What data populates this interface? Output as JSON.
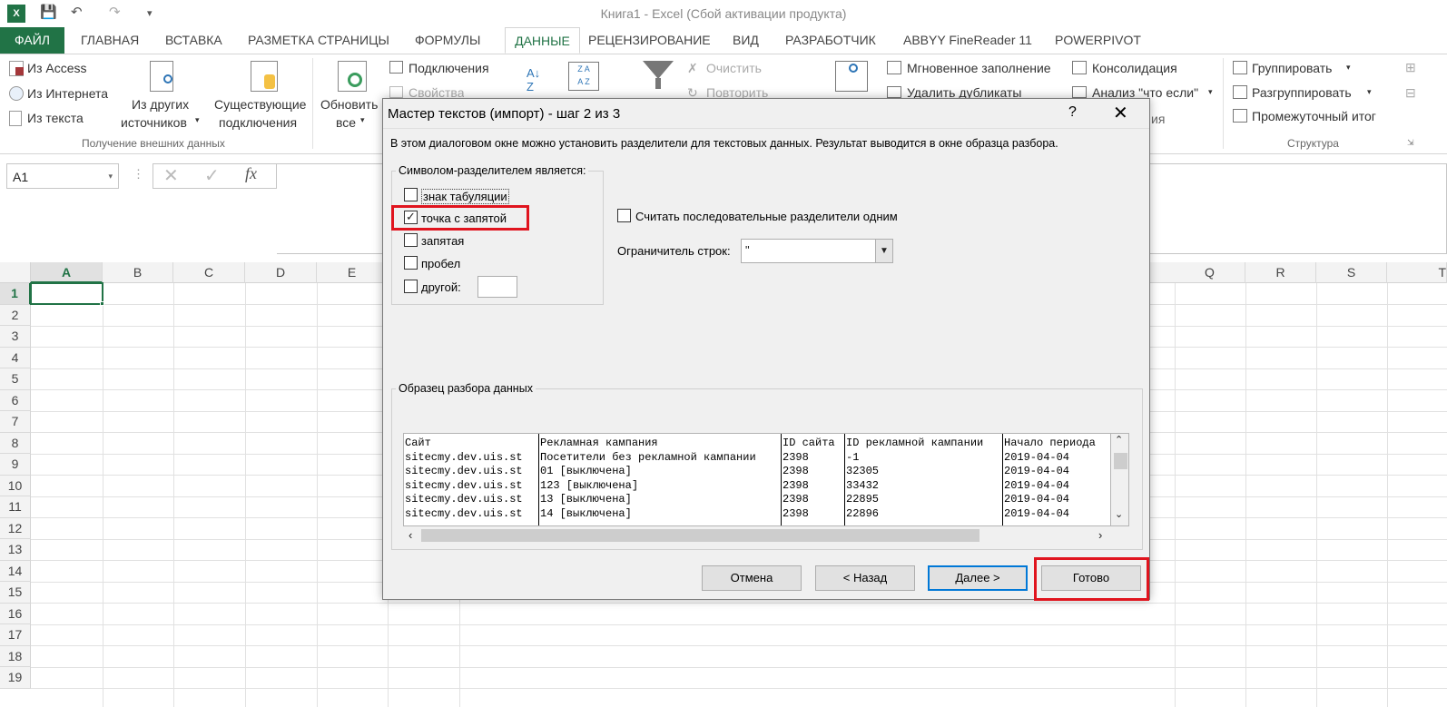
{
  "app": {
    "title": "Книга1 - Excel (Сбой активации продукта)"
  },
  "tabs": {
    "file": "ФАЙЛ",
    "items": [
      "ГЛАВНАЯ",
      "ВСТАВКА",
      "РАЗМЕТКА СТРАНИЦЫ",
      "ФОРМУЛЫ",
      "ДАННЫЕ",
      "РЕЦЕНЗИРОВАНИЕ",
      "ВИД",
      "РАЗРАБОТЧИК",
      "ABBYY FineReader 11",
      "POWERPIVOT"
    ]
  },
  "ribbon": {
    "access": "Из Access",
    "internet": "Из Интернета",
    "text": "Из текста",
    "other_sources_1": "Из других",
    "other_sources_2": "источников",
    "existing_1": "Существующие",
    "existing_2": "подключения",
    "refresh_1": "Обновить",
    "refresh_2": "все",
    "connections": "Подключения",
    "properties": "Свойства",
    "clear": "Очистить",
    "reapply": "Повторить",
    "flash_fill": "Мгновенное заполнение",
    "remove_dup": "Удалить дубликаты",
    "consolidate": "Консолидация",
    "whatif": "Анализ \"что если\"",
    "group": "Группировать",
    "ungroup": "Разгруппировать",
    "subtotal": "Промежуточный итог",
    "group_ext": "Получение внешних данных",
    "group_struct": "Структура",
    "group_partial": "ия"
  },
  "formula": {
    "namebox": "A1",
    "fx": "fx"
  },
  "grid": {
    "columns": [
      "A",
      "B",
      "C",
      "D",
      "E",
      "Q",
      "R",
      "S",
      "T"
    ],
    "rows": [
      "1",
      "2",
      "3",
      "4",
      "5",
      "6",
      "7",
      "8",
      "9",
      "10",
      "11",
      "12",
      "13",
      "14",
      "15",
      "16",
      "17",
      "18",
      "19"
    ]
  },
  "dialog": {
    "title": "Мастер текстов (импорт) - шаг 2 из 3",
    "help": "?",
    "close": "✕",
    "desc": "В этом диалоговом окне можно установить разделители для текстовых данных. Результат выводится в окне образца разбора.",
    "delim_group": "Символом-разделителем является:",
    "delims": [
      {
        "label": "знак табуляции",
        "checked": false
      },
      {
        "label": "точка с запятой",
        "checked": true
      },
      {
        "label": "запятая",
        "checked": false
      },
      {
        "label": "пробел",
        "checked": false
      },
      {
        "label": "другой:",
        "checked": false
      }
    ],
    "consecutive": "Считать последовательные разделители одним",
    "qualifier_label": "Ограничитель строк:",
    "qualifier_value": "\"",
    "preview_group": "Образец разбора данных",
    "preview_cols": [
      [
        "Сайт",
        "sitecmy.dev.uis.st",
        "sitecmy.dev.uis.st",
        "sitecmy.dev.uis.st",
        "sitecmy.dev.uis.st",
        "sitecmy.dev.uis.st"
      ],
      [
        "Рекламная кампания",
        "Посетители без рекламной кампании",
        "01 [выключена]",
        "123 [выключена]",
        "13 [выключена]",
        "14 [выключена]"
      ],
      [
        "ID сайта",
        "2398",
        "2398",
        "2398",
        "2398",
        "2398"
      ],
      [
        "ID рекламной кампании",
        "-1",
        "32305",
        "33432",
        "22895",
        "22896"
      ],
      [
        "Начало периода",
        "2019-04-04",
        "2019-04-04",
        "2019-04-04",
        "2019-04-04",
        "2019-04-04"
      ]
    ],
    "buttons": {
      "cancel": "Отмена",
      "back": "< Назад",
      "next": "Далее >",
      "finish": "Готово"
    },
    "highlight_color": "#e0141e"
  }
}
